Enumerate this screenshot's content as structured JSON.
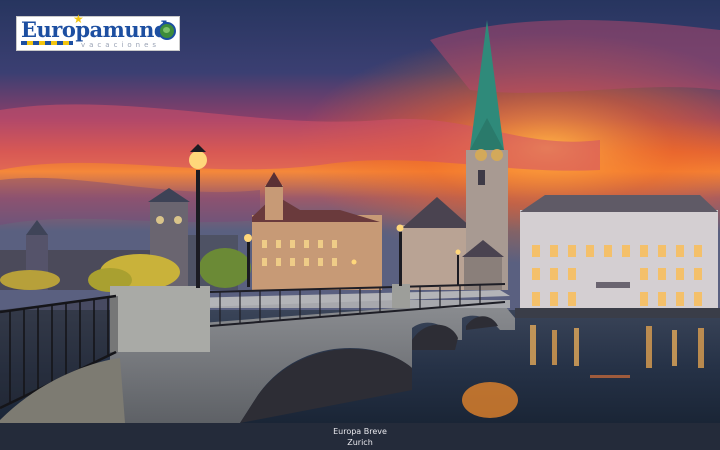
{
  "logo": {
    "brand_text": "Europamund",
    "sub_text": "vacaciones"
  },
  "caption": {
    "line1": "Europa Breve",
    "line2": "Zurich"
  },
  "colors": {
    "sky_top": "#2b3a6a",
    "sunset_orange": "#f26a21",
    "sunset_pink": "#c2416b",
    "spire_green": "#2f8a7a",
    "river": "#1a2a3d",
    "caption_bar": "#242b3a"
  }
}
